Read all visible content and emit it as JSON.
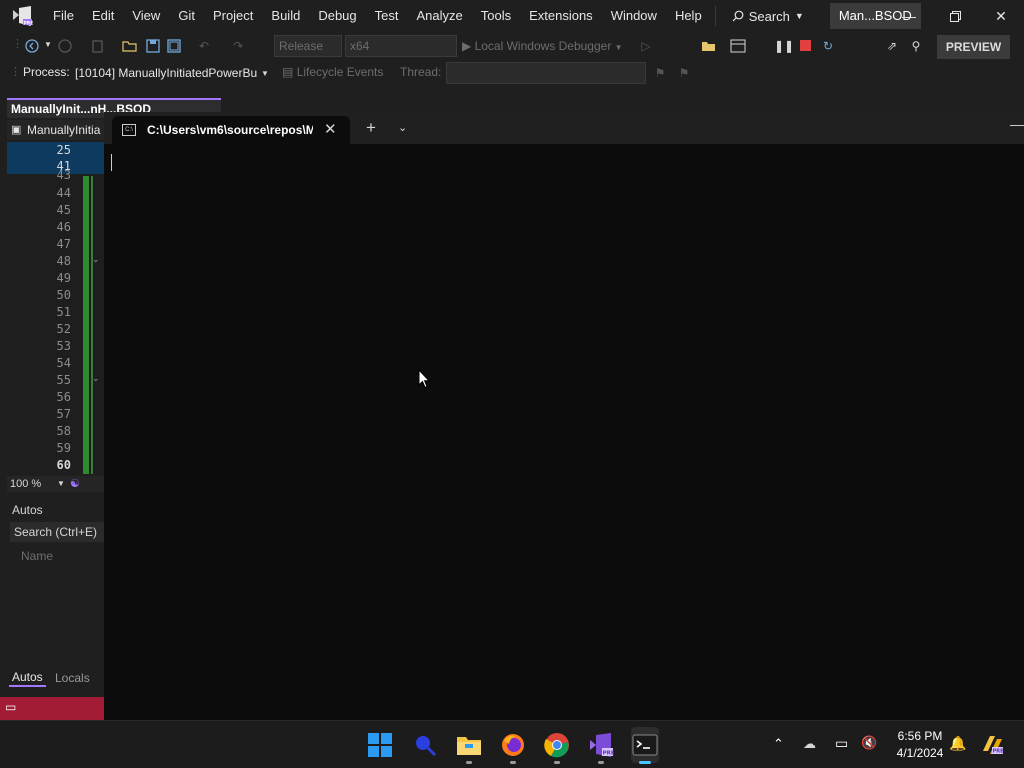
{
  "titlebar": {
    "menu": [
      "File",
      "Edit",
      "View",
      "Git",
      "Project",
      "Build",
      "Debug",
      "Test",
      "Analyze",
      "Tools",
      "Extensions",
      "Window",
      "Help"
    ],
    "search_label": "Search",
    "solution_name": "Man...BSOD"
  },
  "toolbar": {
    "configuration": "Release",
    "platform": "x64",
    "debugger": "Local Windows Debugger",
    "preview_label": "PREVIEW"
  },
  "processbar": {
    "process_label": "Process:",
    "process_value": "[10104] ManuallyInitiatedPowerBu",
    "lifecycle_label": "Lifecycle Events",
    "thread_label": "Thread:"
  },
  "editor": {
    "doc_tab": "ManuallyInit...nH...BSOD",
    "nav_label": "ManuallyInitia",
    "line_numbers": [
      "25",
      "41",
      "43",
      "44",
      "45",
      "46",
      "47",
      "48",
      "49",
      "50",
      "51",
      "52",
      "53",
      "54",
      "55",
      "56",
      "57",
      "58",
      "59",
      "60"
    ],
    "zoom": "100 %"
  },
  "autos": {
    "title": "Autos",
    "search_placeholder": "Search (Ctrl+E)",
    "column_name": "Name",
    "tab_autos": "Autos",
    "tab_locals": "Locals"
  },
  "terminal": {
    "tab_title": "C:\\Users\\vm6\\source\\repos\\M"
  },
  "taskbar": {
    "apps": [
      "windows-start",
      "search",
      "file-explorer",
      "firefox",
      "chrome",
      "visual-studio-preview",
      "terminal"
    ],
    "time": "6:56 PM",
    "date": "4/1/2024"
  },
  "colors": {
    "accent": "#a277ff",
    "status_bar": "#a21c35",
    "terminal_bg": "#0c0c0c"
  }
}
